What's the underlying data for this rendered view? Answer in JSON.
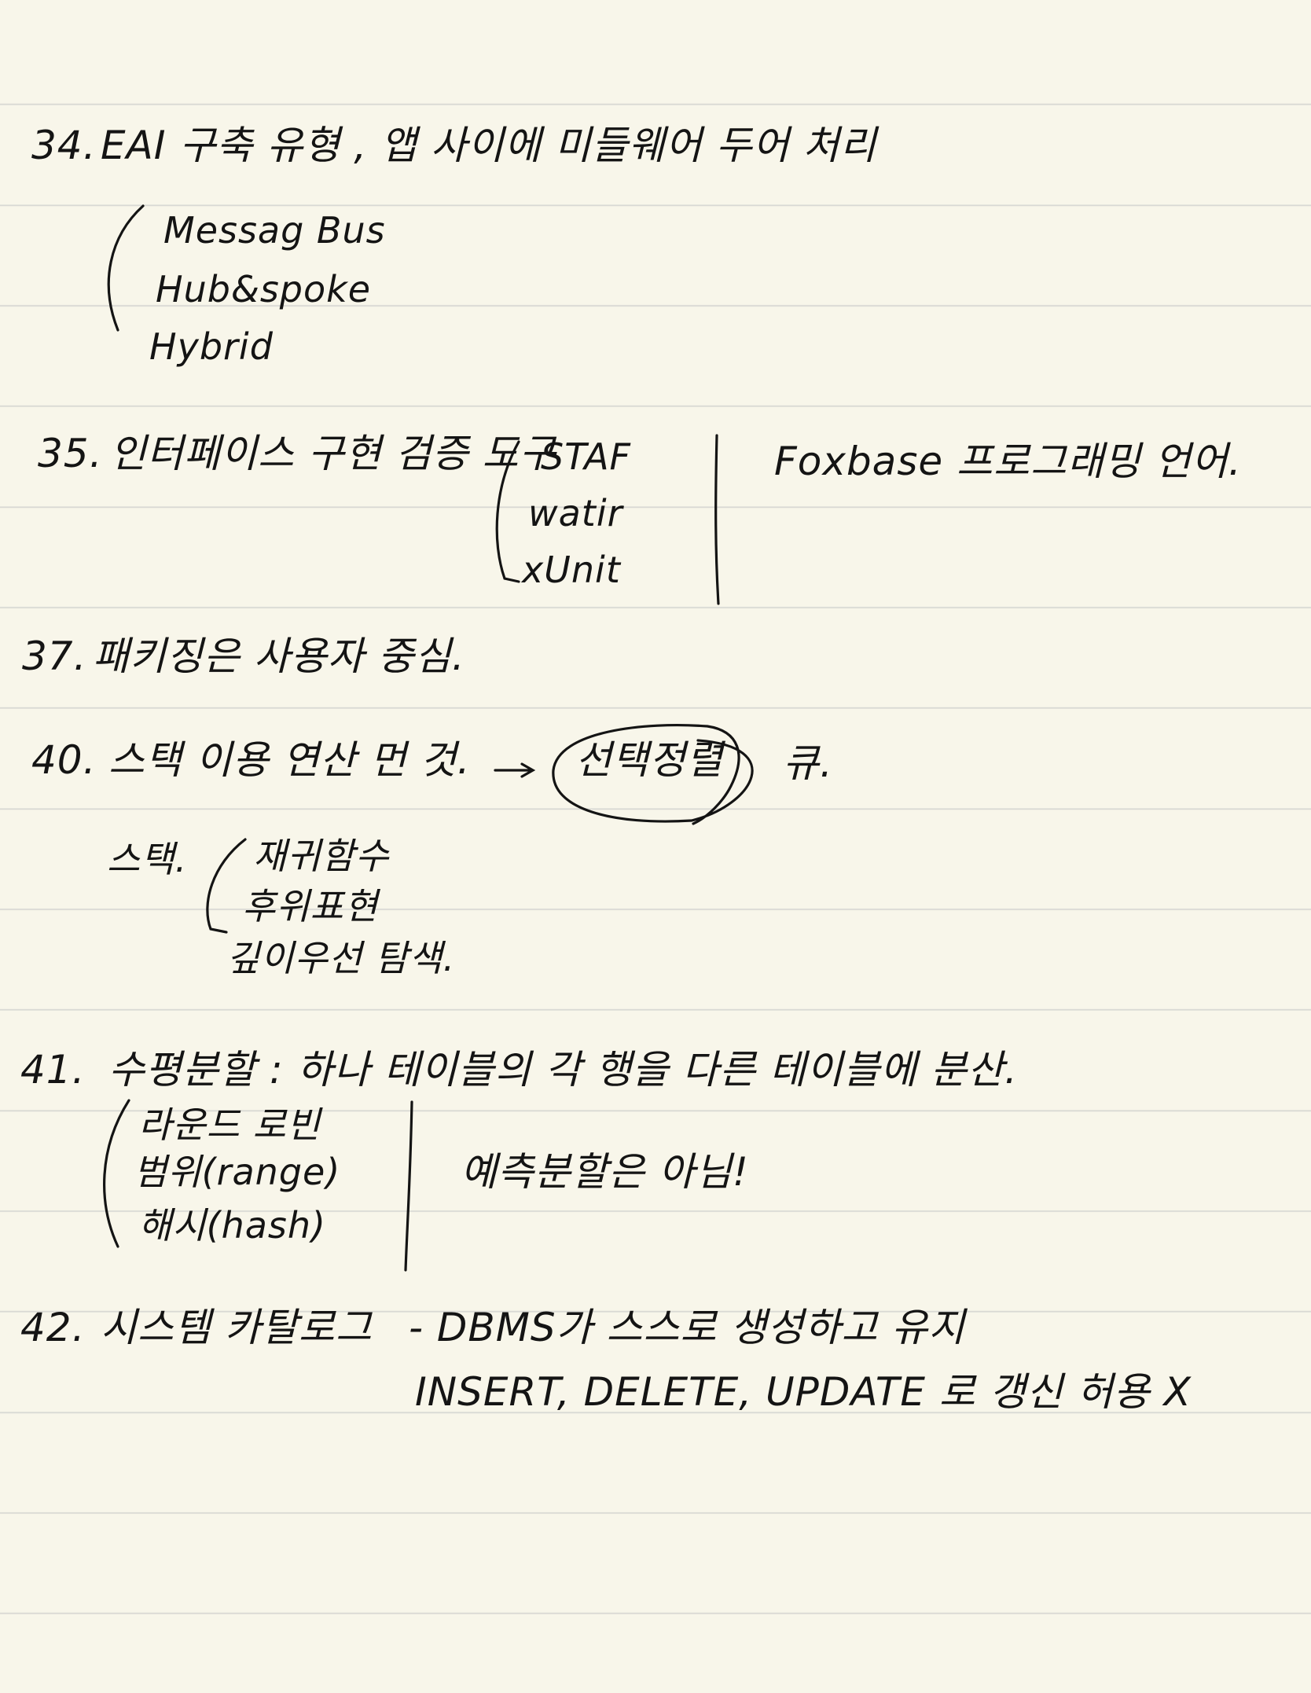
{
  "notes": [
    {
      "id": "q34",
      "number": "34.",
      "text": "EAI 구축 유형 , 앱 사이에 미들웨어 두어 처리",
      "items": [
        "Messag Bus",
        "Hub&spoke",
        "Hybrid"
      ]
    },
    {
      "id": "q35",
      "number": "35.",
      "text": "인터페이스 구현 검증 도구",
      "items": [
        "STAF",
        "watir",
        "xUnit"
      ],
      "side_note": "Foxbase 프로그래밍 언어."
    },
    {
      "id": "q37",
      "number": "37.",
      "text": "패키징은 사용자 중심."
    },
    {
      "id": "q40",
      "number": "40.",
      "text": "스택 이용 연산 먼 것.",
      "circled": "선택정렬",
      "answer": "큐.",
      "sub_label": "스택.",
      "items": [
        "재귀함수",
        "후위표현",
        "깊이우선 탐색."
      ]
    },
    {
      "id": "q41",
      "number": "41.",
      "text": "수평분할 : 하나 테이블의 각 행을 다른 테이블에 분산.",
      "items": [
        "라운드 로빈",
        "범위(range)",
        "해시(hash)"
      ],
      "side_note": "예측분할은 아님!"
    },
    {
      "id": "q42",
      "number": "42.",
      "text": "시스템 카탈로그",
      "detail_1": "- DBMS가 스스로 생성하고 유지",
      "detail_2": "INSERT, DELETE, UPDATE 로 갱신 허용 X"
    }
  ]
}
